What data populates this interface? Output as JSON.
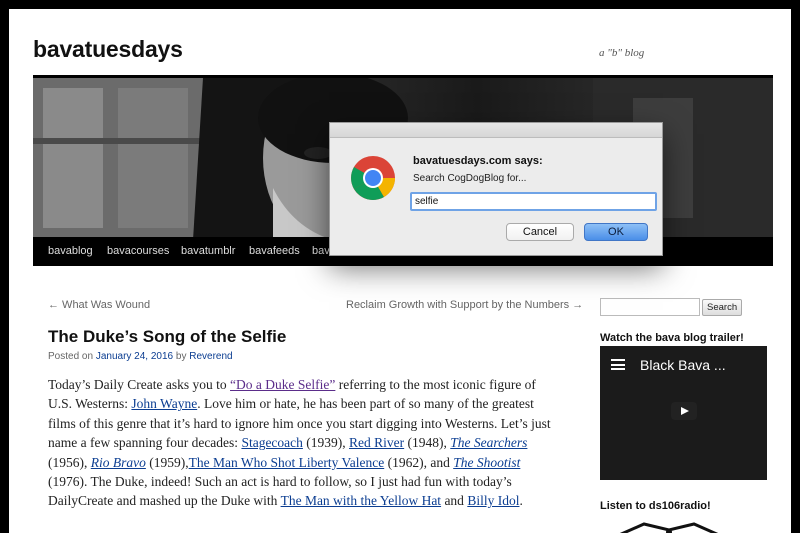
{
  "site": {
    "title": "bavatuesdays",
    "tagline": "a \"b\" blog"
  },
  "nav": {
    "items": [
      "bavablog",
      "bavacourses",
      "bavatumblr",
      "bavafeeds",
      "bav"
    ]
  },
  "post_nav": {
    "prev": "← What Was Wound",
    "next": "Reclaim Growth with Support by the Numbers →"
  },
  "post": {
    "title": "The Duke’s Song of the Selfie",
    "meta": {
      "posted_on": "Posted on",
      "date": "January 24, 2016",
      "by": "by",
      "author": "Reverend"
    },
    "body": {
      "t1": "Today’s Daily Create asks you to ",
      "l1": "“Do a Duke Selfie”",
      "t2": " referring to the most iconic figure of U.S. Westerns: ",
      "l2": "John Wayne",
      "t3": ". Love him or hate, he has been part of so many of the greatest films of this genre that it’s hard to ignore him once you start digging into Westerns. Let’s just name a few spanning four decades: ",
      "l3": "Stagecoach",
      "t4": " (1939), ",
      "l4": "Red River",
      "t5": " (1948), ",
      "l5": "The Searchers",
      "t6": " (1956), ",
      "l6": "Rio Bravo",
      "t7": " (1959),",
      "l7": "The Man Who Shot Liberty Valence",
      "t8": " (1962), and ",
      "l8": "The Shootist",
      "t9": " (1976). The Duke, indeed! Such an act is hard to follow, so I just had fun with today’s DailyCreate and mashed up the Duke with ",
      "l9": "The Man with the Yellow Hat",
      "t10": " and ",
      "l10": "Billy Idol",
      "t11": "."
    }
  },
  "sidebar": {
    "search_button": "Search",
    "video_heading": "Watch the bava blog trailer!",
    "video_title": "Black Bava ...",
    "radio_heading": "Listen to ds106radio!"
  },
  "dialog": {
    "title": "bavatuesdays.com says:",
    "message": "Search CogDogBlog for...",
    "input_value": "selfie",
    "cancel_label": "Cancel",
    "ok_label": "OK"
  },
  "colors": {
    "link": "#0b3d91",
    "visited_link": "#5b2d8a",
    "ok_button": "#4a8ee8"
  },
  "icons": [
    "chrome-logo-icon",
    "menu-icon",
    "play-icon"
  ]
}
